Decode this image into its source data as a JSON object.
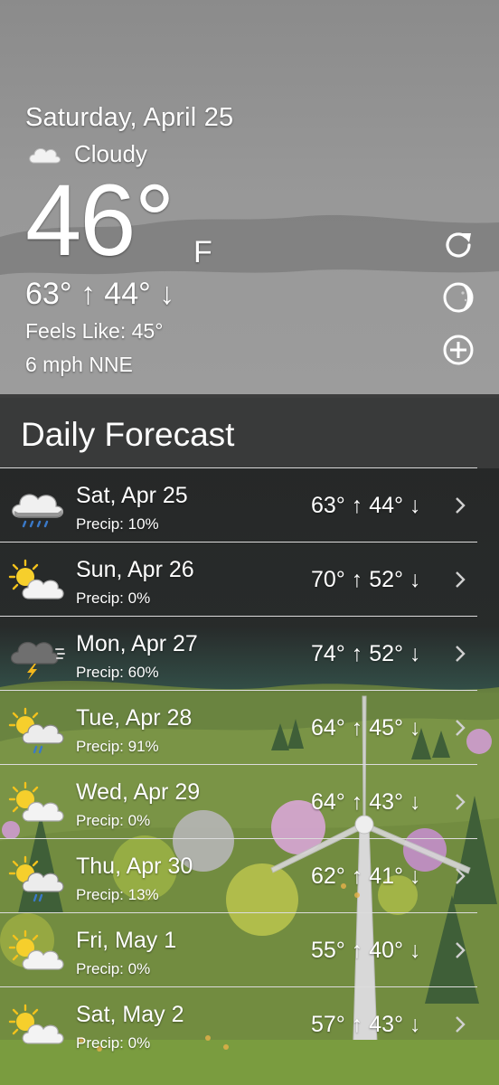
{
  "current": {
    "date": "Saturday, April 25",
    "condition": "Cloudy",
    "condition_icon": "cloud-icon",
    "temperature": "46°",
    "unit": "F",
    "high_low": "63° ↑  44° ↓",
    "feels_like": "Feels Like: 45°",
    "wind": "6 mph NNE"
  },
  "actions": [
    {
      "name": "refresh-icon"
    },
    {
      "name": "moon-phase-icon"
    },
    {
      "name": "add-icon"
    }
  ],
  "forecast": {
    "title": "Daily Forecast",
    "days": [
      {
        "day": "Sat, Apr 25",
        "precip": "Precip: 10%",
        "temps": "63° ↑  44° ↓",
        "icon": "rain-cloud-icon"
      },
      {
        "day": "Sun, Apr 26",
        "precip": "Precip: 0%",
        "temps": "70° ↑  52° ↓",
        "icon": "partly-cloudy-icon"
      },
      {
        "day": "Mon, Apr 27",
        "precip": "Precip: 60%",
        "temps": "74° ↑  52° ↓",
        "icon": "thunderstorm-icon"
      },
      {
        "day": "Tue, Apr 28",
        "precip": "Precip: 91%",
        "temps": "64° ↑  45° ↓",
        "icon": "sun-rain-cloud-icon"
      },
      {
        "day": "Wed, Apr 29",
        "precip": "Precip: 0%",
        "temps": "64° ↑  43° ↓",
        "icon": "partly-cloudy-icon"
      },
      {
        "day": "Thu, Apr 30",
        "precip": "Precip: 13%",
        "temps": "62° ↑  41° ↓",
        "icon": "sun-rain-cloud-icon"
      },
      {
        "day": "Fri, May 1",
        "precip": "Precip: 0%",
        "temps": "55° ↑  40° ↓",
        "icon": "partly-cloudy-icon"
      },
      {
        "day": "Sat, May 2",
        "precip": "Precip: 0%",
        "temps": "57° ↑  43° ↓",
        "icon": "partly-cloudy-icon"
      }
    ]
  },
  "colors": {
    "sky": "#8e8e8e",
    "panel": "#3a3a3a",
    "hills": "#6f8a3f",
    "sun": "#f3c21c",
    "rain": "#3a79c8"
  }
}
